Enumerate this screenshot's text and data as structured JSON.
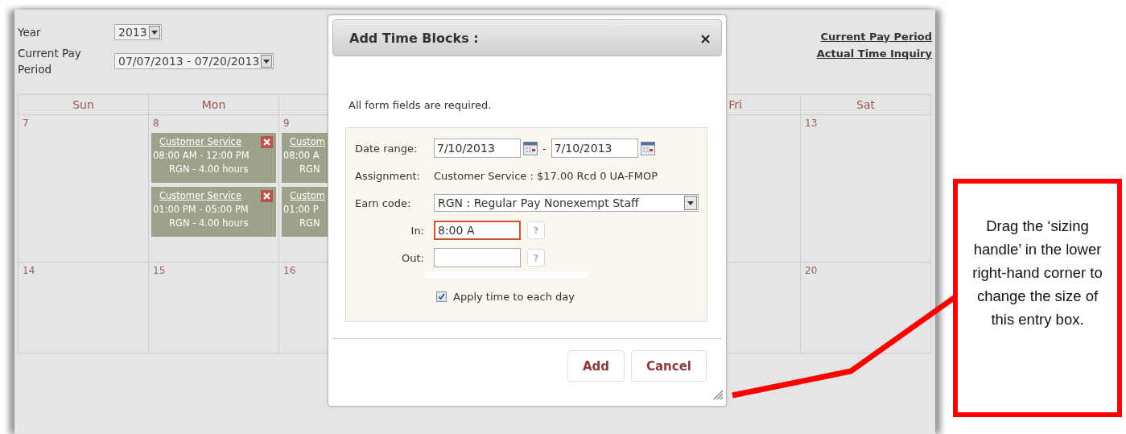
{
  "panel": {
    "year": {
      "label": "Year",
      "value": "2013"
    },
    "pay_period": {
      "label": "Current Pay Period",
      "value": "07/07/2013 - 07/20/2013"
    },
    "links": [
      "Current Pay Period",
      "Actual Time Inquiry"
    ]
  },
  "calendar": {
    "columns": {
      "start": [
        "Sun",
        "Mon"
      ],
      "end": [
        "Fri",
        "Sat"
      ]
    },
    "weeks": [
      {
        "start": [
          {
            "day": "7"
          },
          {
            "day": "8",
            "blocks": [
              {
                "title": "Customer Service",
                "time": "08:00 AM - 12:00 PM",
                "code": "RGN - 4.00 hours",
                "removable": true
              },
              {
                "title": "Customer Service",
                "time": "01:00 PM - 05:00 PM",
                "code": "RGN - 4.00 hours",
                "removable": true
              }
            ]
          },
          {
            "day": "9",
            "blocks": [
              {
                "title": "Custom",
                "time": "08:00 A",
                "code": "RGN"
              },
              {
                "title": "Custom",
                "time": "01:00 P",
                "code": "RGN"
              }
            ]
          }
        ],
        "end": [
          {
            "day": "13"
          }
        ]
      },
      {
        "start": [
          {
            "day": "14"
          },
          {
            "day": "15"
          },
          {
            "day": "16"
          }
        ],
        "end": [
          {
            "day": "20"
          }
        ]
      }
    ]
  },
  "dialog": {
    "title": "Add Time Blocks :",
    "close": "×",
    "note": "All form fields are required.",
    "rows": [
      {
        "kind": "date_range",
        "label": "Date range:",
        "from": "7/10/2013",
        "separator": "-",
        "to": "7/10/2013"
      },
      {
        "kind": "text",
        "label": "Assignment:",
        "value": "Customer Service : $17.00 Rcd 0 UA-FMOP"
      },
      {
        "kind": "select",
        "label": "Earn code:",
        "value": "RGN : Regular Pay Nonexempt Staff"
      },
      {
        "kind": "time",
        "label": "In:",
        "value": "8:00 A",
        "focused": true,
        "help": "?"
      },
      {
        "kind": "time",
        "label": "Out:",
        "focused": false,
        "help": "?"
      },
      {
        "kind": "checkbox",
        "label": "Apply time to each day",
        "checked": true
      }
    ],
    "buttons": [
      "Add",
      "Cancel"
    ]
  },
  "callout": {
    "text": "Drag the ‘sizing handle’ in the lower right-hand corner to change the size of this entry box."
  }
}
